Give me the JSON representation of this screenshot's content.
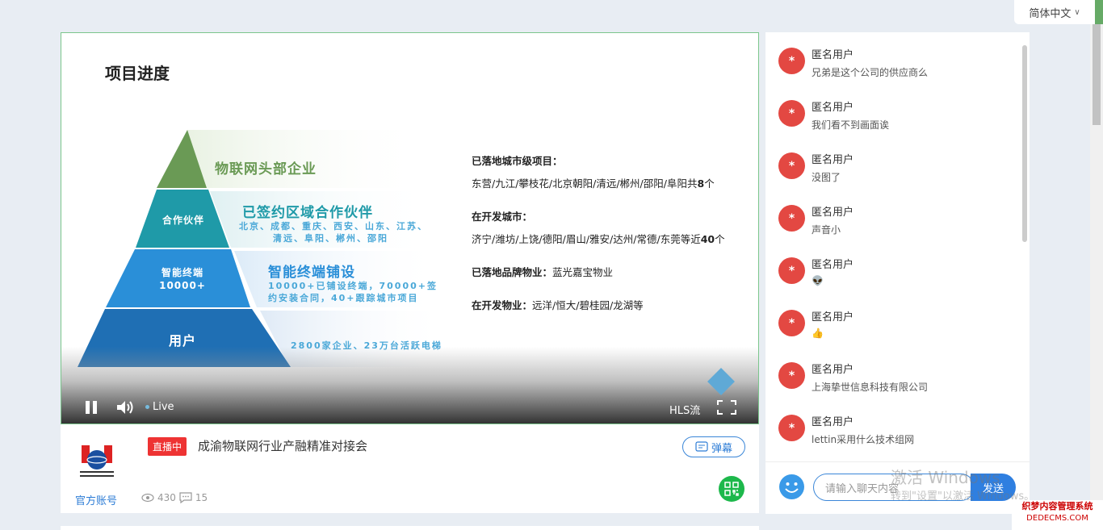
{
  "language": {
    "label": "简体中文"
  },
  "slide": {
    "title": "项目进度",
    "pyramid": {
      "top": {
        "big": "物联网头部企业"
      },
      "l2": {
        "label": "合作伙伴",
        "big": "已签约区域合作伙伴",
        "small1": "北京、成都、重庆、西安、山东、江苏、",
        "small2": "清远、阜阳、郴州、邵阳"
      },
      "l3": {
        "label1": "智能终端",
        "label2": "10000+",
        "big": "智能终端铺设",
        "small1": "10000+已铺设终端，70000+签",
        "small2": "约安装合同，40+跟踪城市项目"
      },
      "l4": {
        "label": "用户",
        "small": "2800家企业、23万台活跃电梯"
      }
    },
    "info": {
      "b1_head": "已落地城市级项目：",
      "b1_text": "东营/九江/攀枝花/北京朝阳/清远/郴州/邵阳/阜阳共",
      "b1_num": "8",
      "b1_unit": "个",
      "b2_head": "在开发城市：",
      "b2_text": "济宁/潍坊/上饶/德阳/眉山/雅安/达州/常德/东莞等近",
      "b2_num": "40",
      "b2_unit": "个",
      "b3_head": "已落地品牌物业：",
      "b3_text": "蓝光嘉宝物业",
      "b4_head": "在开发物业：",
      "b4_text": "远洋/恒大/碧桂园/龙湖等"
    }
  },
  "controls": {
    "live": "Live",
    "stream": "HLS流"
  },
  "stream_info": {
    "badge": "直播中",
    "title": "成渝物联网行业产融精准对接会",
    "official": "官方账号",
    "views": "430",
    "comments": "15",
    "danmu": "弹幕"
  },
  "chat": {
    "messages": [
      {
        "user": "匿名用户",
        "text": "兄弟是这个公司的供应商么"
      },
      {
        "user": "匿名用户",
        "text": "我们看不到画面诶"
      },
      {
        "user": "匿名用户",
        "text": "没图了"
      },
      {
        "user": "匿名用户",
        "text": "声音小"
      },
      {
        "user": "匿名用户",
        "text": "👽"
      },
      {
        "user": "匿名用户",
        "text": "👍"
      },
      {
        "user": "匿名用户",
        "text": "上海挚世信息科技有限公司"
      },
      {
        "user": "匿名用户",
        "text": "lettin采用什么技术组网"
      }
    ],
    "avatar_char": "*",
    "input_placeholder": "请输入聊天内容",
    "send_label": "发送"
  },
  "overlay": {
    "activate_title": "激活 Windows",
    "activate_sub": "转到\"设置\"以激活 Windows。",
    "watermark1": "织梦内容管理系统",
    "watermark2": "DEDECMS.COM"
  },
  "colors": {
    "accent": "#2f7fe0",
    "live_red": "#e33333",
    "avatar_red": "#e34842",
    "qr_green": "#1db84b"
  }
}
